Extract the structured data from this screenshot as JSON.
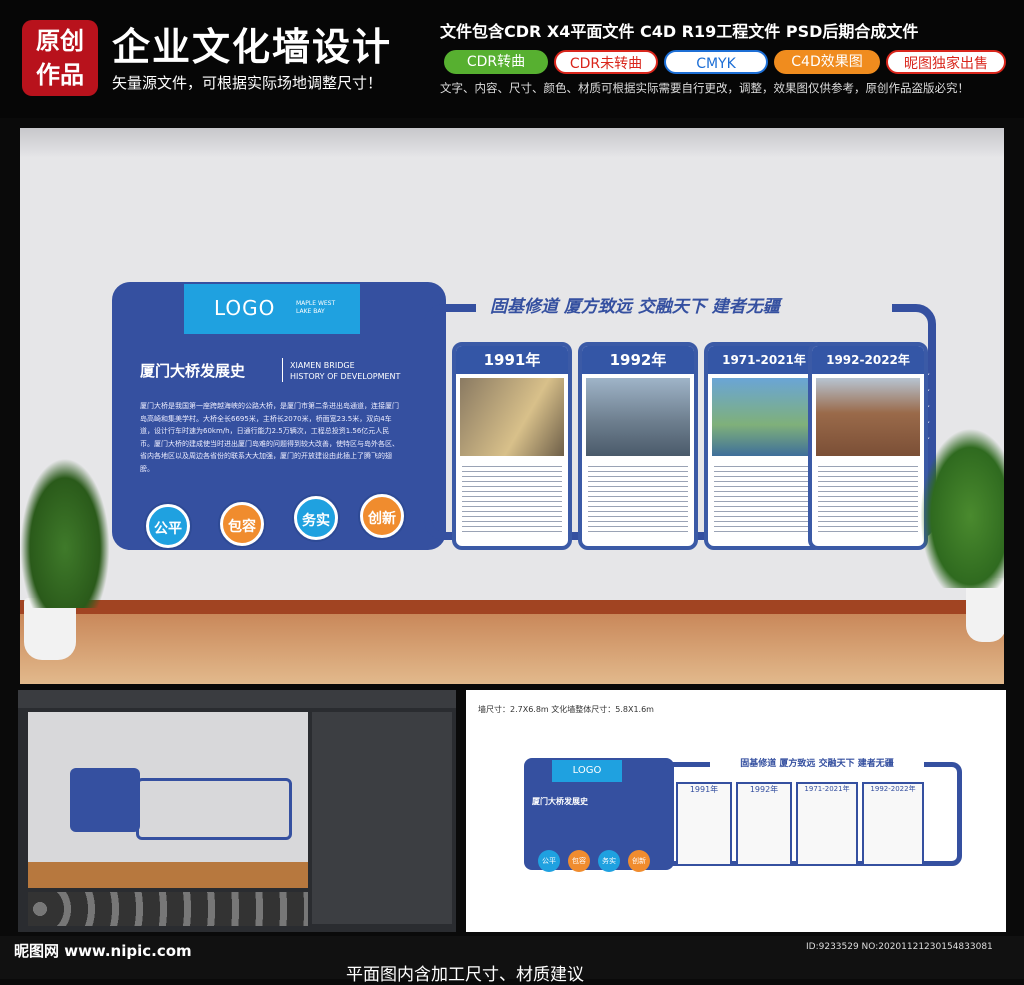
{
  "header": {
    "badge": {
      "line1": "原创",
      "line2": "作品"
    },
    "title": "企业文化墙设计",
    "subtitle": "矢量源文件，可根据实际场地调整尺寸！",
    "formats": "文件包含CDR X4平面文件  C4D R19工程文件  PSD后期合成文件",
    "tags": [
      "CDR转曲",
      "CDR未转曲",
      "CMYK",
      "C4D效果图",
      "昵图独家出售"
    ],
    "notice": "文字、内容、尺寸、颜色、材质可根据实际需要自行更改，调整，效果图仅供参考，原创作品盗版必究！",
    "tag_colors": {
      "green": "#57b030",
      "red": "#d9261c",
      "orange": "#f08c1e",
      "blue": "#1d6fd6"
    }
  },
  "wall": {
    "logo": "LOGO",
    "logo_small": "MAPLE WEST LAKE BAY",
    "heading_cn": "厦门大桥发展史",
    "heading_en_1": "XIAMEN BRIDGE",
    "heading_en_2": "HISTORY OF DEVELOPMENT",
    "intro": "厦门大桥是我国第一座跨越海峡的公路大桥，是厦门市第二条进出岛通道，连接厦门岛高崎和集美学村。大桥全长6695米，主桥长2070米，桥面宽23.5米，双向4车道，设计行车时速为60km/h，日通行能力2.5万辆次，工程总投资1.56亿元人民币。厦门大桥的建成使当时进出厦门岛难的问题得到较大改善，使特区与岛外各区、省内各地区以及周边各省份的联系大大加强，厦门的开放建设由此插上了腾飞的翅膀。",
    "values": [
      "公平",
      "包容",
      "务实",
      "创新"
    ],
    "slogan": "固基修道  厦方致远  交融天下  建者无疆",
    "cards": [
      "1991年",
      "1992年",
      "1971-2021年",
      "1992-2022年"
    ],
    "stars": "★★★★★",
    "colors": {
      "primary": "#3550a0",
      "accent": "#1fa1e0"
    }
  },
  "drawing": {
    "size_note": "墙尺寸：2.7X6.8m  文化墙整体尺寸：5.8X1.6m",
    "values": [
      "公平",
      "包容",
      "务实",
      "创新"
    ]
  },
  "footer": {
    "site": "昵图网 www.nipic.com",
    "id": "ID:9233529 NO:20201121230154833081",
    "caption": "平面图内含加工尺寸、材质建议"
  }
}
